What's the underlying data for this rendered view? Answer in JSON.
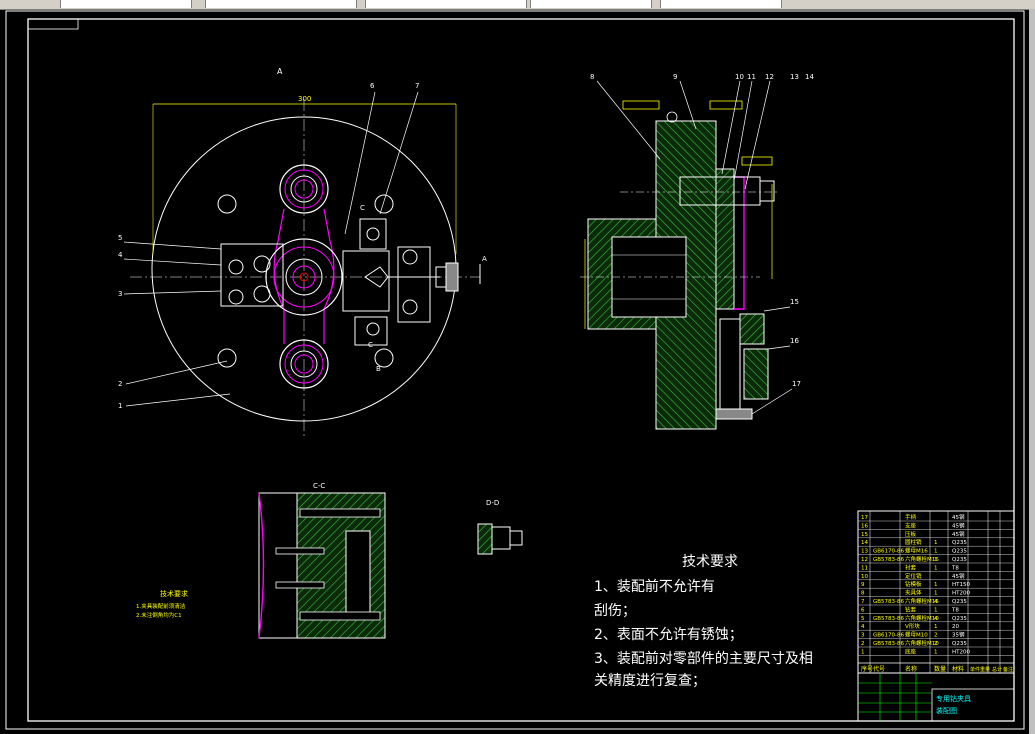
{
  "window": {
    "toolbar_fields": [
      "",
      "",
      "",
      "",
      ""
    ]
  },
  "drawing": {
    "balloons": [
      "1",
      "2",
      "3",
      "4",
      "5",
      "6",
      "7",
      "8",
      "9",
      "10",
      "11",
      "12",
      "13",
      "14",
      "15",
      "16",
      "17"
    ],
    "section_labels": {
      "a_top": "A",
      "a_right": "A",
      "b_mark": "B",
      "c_top": "C",
      "c_bottom": "C",
      "cc_section": "C-C",
      "dd_section": "D-D",
      "dim_top": "300"
    },
    "small_notes": {
      "title": "技术要求",
      "line1": "1.夹具装配前须清洁",
      "line2": "2.未注倒角均为C1"
    },
    "tech_requirements": {
      "title": "技术要求",
      "line1": "1、装配前不允许有",
      "line2": "刮伤；",
      "line3": "2、表面不允许有锈蚀；",
      "line4": "3、装配前对零部件的主要尺寸及相",
      "line5": "关精度进行复查；"
    },
    "title_block": {
      "bom_rows": [
        {
          "no": "17",
          "code": "",
          "name": "手柄",
          "qty": "",
          "material": "45钢"
        },
        {
          "no": "16",
          "code": "",
          "name": "支座",
          "qty": "",
          "material": "45钢"
        },
        {
          "no": "15",
          "code": "",
          "name": "压板",
          "qty": "",
          "material": "45钢"
        },
        {
          "no": "14",
          "code": "",
          "name": "圆柱销",
          "qty": "1",
          "material": "Q235"
        },
        {
          "no": "13",
          "code": "GB6170-86",
          "name": "螺母M16",
          "qty": "1",
          "material": "Q235"
        },
        {
          "no": "12",
          "code": "GB5783-86",
          "name": "六角螺栓M16",
          "qty": "1",
          "material": "Q235"
        },
        {
          "no": "11",
          "code": "",
          "name": "衬套",
          "qty": "1",
          "material": "T8"
        },
        {
          "no": "10",
          "code": "",
          "name": "定位销",
          "qty": "",
          "material": "45钢"
        },
        {
          "no": "9",
          "code": "",
          "name": "钻模板",
          "qty": "1",
          "material": "HT150"
        },
        {
          "no": "8",
          "code": "",
          "name": "夹具体",
          "qty": "1",
          "material": "HT200"
        },
        {
          "no": "7",
          "code": "GB5783-86",
          "name": "六角螺栓M16",
          "qty": "4",
          "material": "Q235"
        },
        {
          "no": "6",
          "code": "",
          "name": "钻套",
          "qty": "1",
          "material": "T8"
        },
        {
          "no": "5",
          "code": "GB5783-86",
          "name": "六角螺栓M10",
          "qty": "4",
          "material": "Q235"
        },
        {
          "no": "4",
          "code": "",
          "name": "V形块",
          "qty": "1",
          "material": "20"
        },
        {
          "no": "3",
          "code": "GB6170-86",
          "name": "螺母M10",
          "qty": "2",
          "material": "35钢"
        },
        {
          "no": "2",
          "code": "GB5783-86",
          "name": "六角螺栓M10",
          "qty": "2",
          "material": "Q235"
        },
        {
          "no": "1",
          "code": "",
          "name": "底座",
          "qty": "1",
          "material": "HT200"
        }
      ],
      "header": {
        "no": "序号",
        "code": "代号",
        "name": "名称",
        "qty": "数量",
        "material": "材料",
        "unit_weight": "单件重量",
        "total_weight": "总计",
        "note": "备注"
      },
      "drawing_name_1": "专用钻夹具",
      "drawing_name_2": "装配图"
    }
  },
  "colors": {
    "background": "#000000",
    "line_white": "#ffffff",
    "line_yellow": "#ffff00",
    "line_green": "#00ff00",
    "line_magenta": "#ff00ff",
    "line_cyan": "#00ffff"
  }
}
